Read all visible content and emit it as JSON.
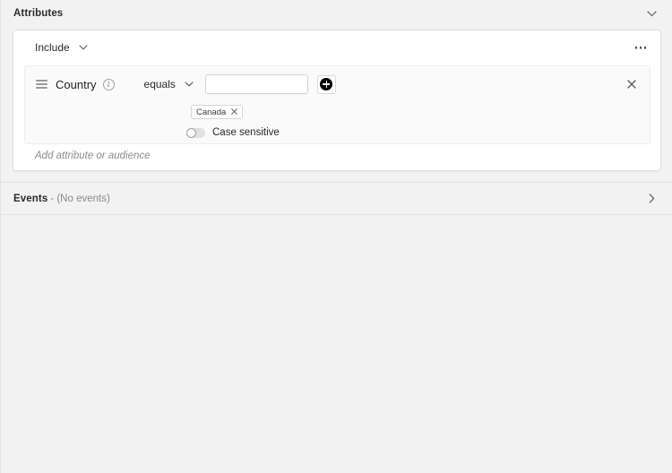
{
  "attributes_section": {
    "title": "Attributes",
    "collapse_icon": "chevron-down-icon",
    "overflow_menu_label": "...",
    "scope_select": {
      "value": "Include",
      "chevron_icon": "chevron-down-icon"
    },
    "conditions": [
      {
        "drag_handle_icon": "drag-handle-icon",
        "attribute_name": "Country",
        "info_icon": "info-icon",
        "operator": "equals",
        "operator_chevron_icon": "chevron-down-icon",
        "value_input": "",
        "value_placeholder": "",
        "add_value_icon": "plus-circle-icon",
        "remove_icon": "close-icon",
        "tags": [
          {
            "label": "Canada",
            "remove_icon": "close-icon"
          }
        ],
        "case_sensitive": {
          "label": "Case sensitive",
          "enabled": false
        }
      }
    ],
    "add_row_placeholder": "Add attribute or audience"
  },
  "events_section": {
    "title": "Events",
    "summary": " - (No events)",
    "expand_icon": "chevron-right-icon"
  },
  "colors": {
    "page_bg": "#f2f2f2",
    "card_bg": "#ffffff",
    "group_bg": "#fafafa",
    "border": "#e0e0e0",
    "text": "#1f1f1f",
    "muted_text": "#8a8a8a",
    "accent": "#000000"
  }
}
